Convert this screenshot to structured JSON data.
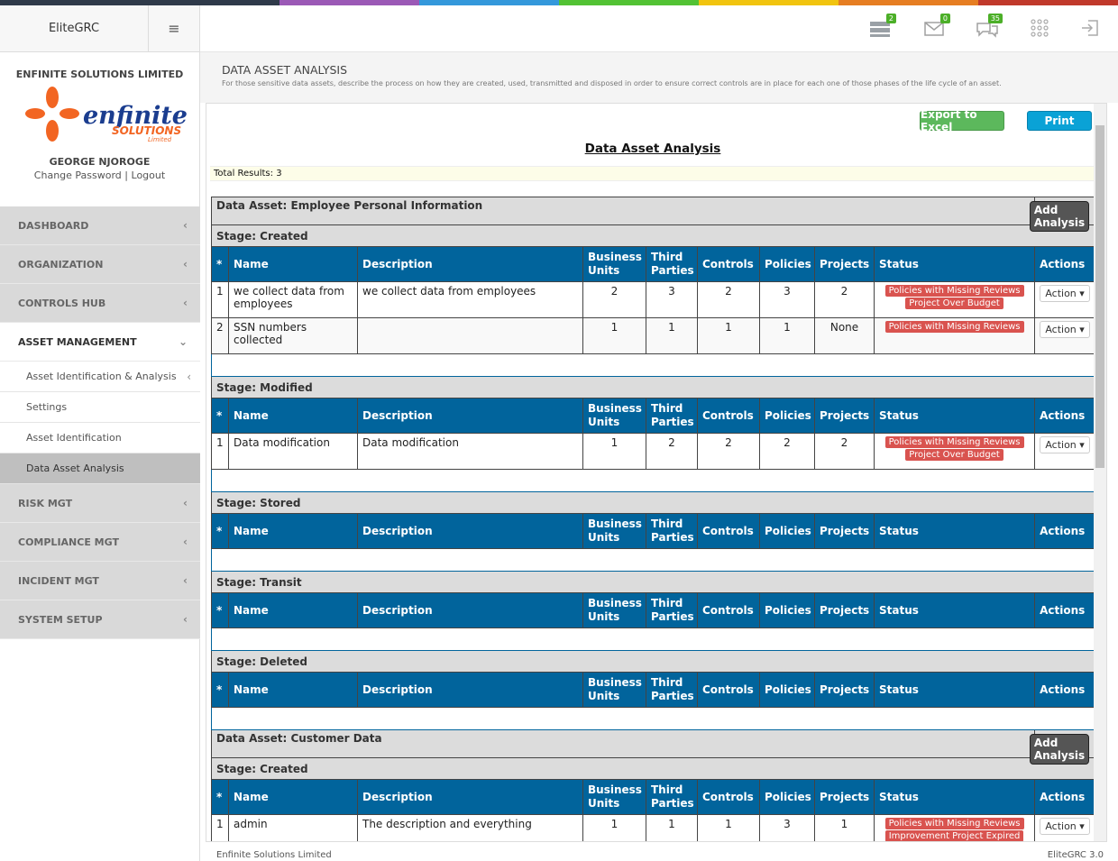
{
  "brand": "EliteGRC",
  "company": "ENFINITE SOLUTIONS LIMITED",
  "logo": {
    "word": "enfinite",
    "sub": "SOLUTIONS",
    "tiny": "Limited"
  },
  "user": {
    "name": "GEORGE NJOROGE",
    "change_password": "Change Password",
    "sep": "|",
    "logout": "Logout"
  },
  "menu": {
    "dashboard": "DASHBOARD",
    "organization": "ORGANIZATION",
    "controls": "CONTROLS HUB",
    "asset": "ASSET MANAGEMENT",
    "sub1": "Asset Identification & Analysis",
    "sub2": "Settings",
    "sub3": "Asset Identification",
    "sub4": "Data Asset Analysis",
    "risk": "RISK MGT",
    "compliance": "COMPLIANCE MGT",
    "incident": "INCIDENT MGT",
    "system": "SYSTEM SETUP"
  },
  "topbar": {
    "badge_tasks": "2",
    "badge_mail": "0",
    "badge_messages": "35"
  },
  "header": {
    "title": "DATA ASSET ANALYSIS",
    "subtitle": "For those sensitive data assets, describe the process on how they are created, used, transmitted and disposed in order to ensure correct controls are in place for each one of those phases of the life cycle of an asset."
  },
  "report": {
    "export": "Export to Excel",
    "print": "Print",
    "title": "Data Asset Analysis",
    "total": "Total Results: 3"
  },
  "cols": {
    "star": "*",
    "name": "Name",
    "desc": "Description",
    "bu1": "Business",
    "bu2": "Units",
    "tp1": "Third",
    "tp2": "Parties",
    "controls": "Controls",
    "policies": "Policies",
    "projects": "Projects",
    "status": "Status",
    "actions": "Actions"
  },
  "add_analysis": "Add Analysis",
  "action_label": "Action",
  "assets": [
    {
      "title": "Data Asset: Employee Personal Information",
      "stages": {
        "created": {
          "label": "Stage: Created",
          "rows": [
            {
              "no": "1",
              "name": "we collect data from employees",
              "desc": "we collect data from employees",
              "bu": "2",
              "tp": "3",
              "controls": "2",
              "policies": "3",
              "projects": "2",
              "s1": "Policies with Missing Reviews",
              "s2": "Project Over Budget"
            },
            {
              "no": "2",
              "name": "SSN numbers collected",
              "desc": "",
              "bu": "1",
              "tp": "1",
              "controls": "1",
              "policies": "1",
              "projects": "None",
              "s1": "Policies with Missing Reviews"
            }
          ]
        },
        "modified": {
          "label": "Stage: Modified",
          "rows": [
            {
              "no": "1",
              "name": "Data modification",
              "desc": "Data modification",
              "bu": "1",
              "tp": "2",
              "controls": "2",
              "policies": "2",
              "projects": "2",
              "s1": "Policies with Missing Reviews",
              "s2": "Project Over Budget"
            }
          ]
        },
        "stored": {
          "label": "Stage: Stored"
        },
        "transit": {
          "label": "Stage: Transit"
        },
        "deleted": {
          "label": "Stage: Deleted"
        }
      }
    },
    {
      "title": "Data Asset: Customer Data",
      "stages": {
        "created": {
          "label": "Stage: Created",
          "rows": [
            {
              "no": "1",
              "name": "admin",
              "desc": "The description and everything",
              "bu": "1",
              "tp": "1",
              "controls": "1",
              "policies": "3",
              "projects": "1",
              "s1": "Policies with Missing Reviews",
              "s2": "Improvement Project Expired"
            }
          ]
        }
      }
    }
  ],
  "footer": {
    "left": "Enfinite Solutions Limited",
    "right": "EliteGRC 3.0"
  },
  "colors": {
    "accent": "#01649c",
    "green": "#5cb85c",
    "print": "#0aa2d6",
    "danger": "#d9534f"
  }
}
